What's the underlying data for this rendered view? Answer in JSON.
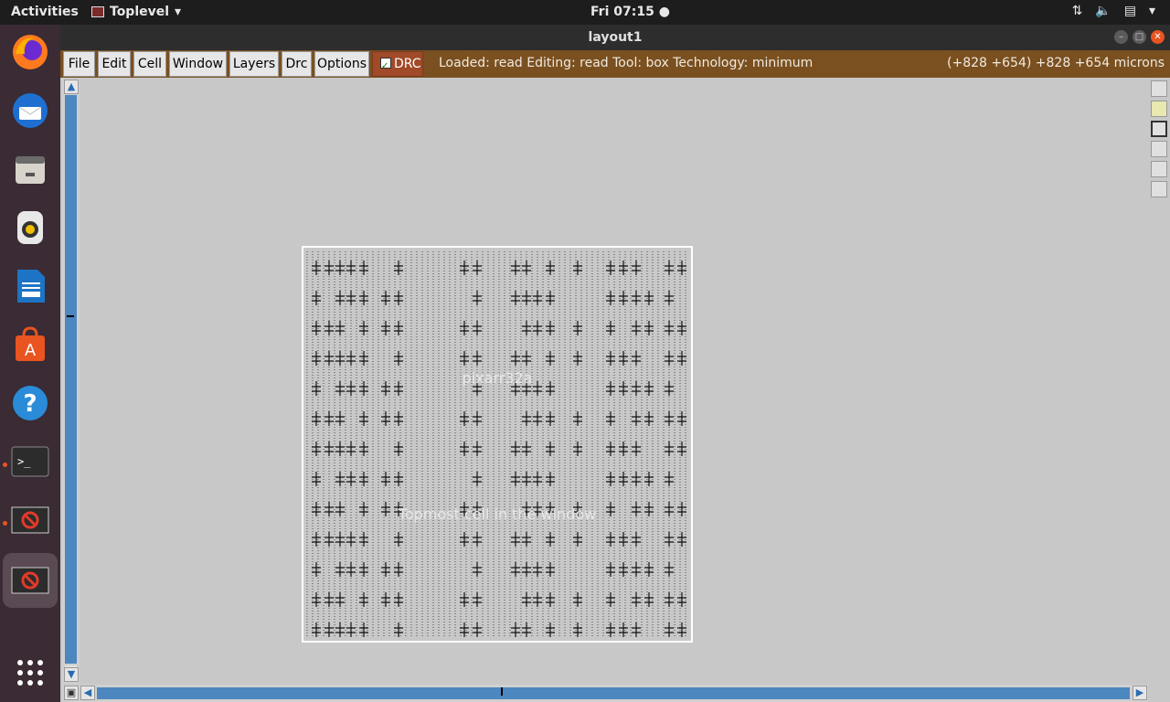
{
  "topbar": {
    "activities": "Activities",
    "app_name": "Toplevel",
    "clock": "Fri 07:15"
  },
  "dock": {
    "items": [
      "firefox-icon",
      "thunderbird-icon",
      "files-icon",
      "rhythmbox-icon",
      "writer-icon",
      "software-icon",
      "help-icon",
      "terminal-icon",
      "magic-icon",
      "magic-icon"
    ]
  },
  "window": {
    "title": "layout1",
    "menu": [
      "File",
      "Edit",
      "Cell",
      "Window",
      "Layers",
      "Drc",
      "Options"
    ],
    "drc_label": "DRC",
    "status": "Loaded: read Editing: read Tool: box  Technology: minimum",
    "coords": "(+828 +654) +828 +654 microns"
  },
  "canvas": {
    "cell_name": "pixarr32a",
    "hint": "Topmost cell in the window"
  },
  "colors": {
    "menubar": "#7a5020",
    "drc_active": "#a04a28",
    "scrollbar": "#4d87c0",
    "canvas_bg": "#c8c8c8"
  }
}
